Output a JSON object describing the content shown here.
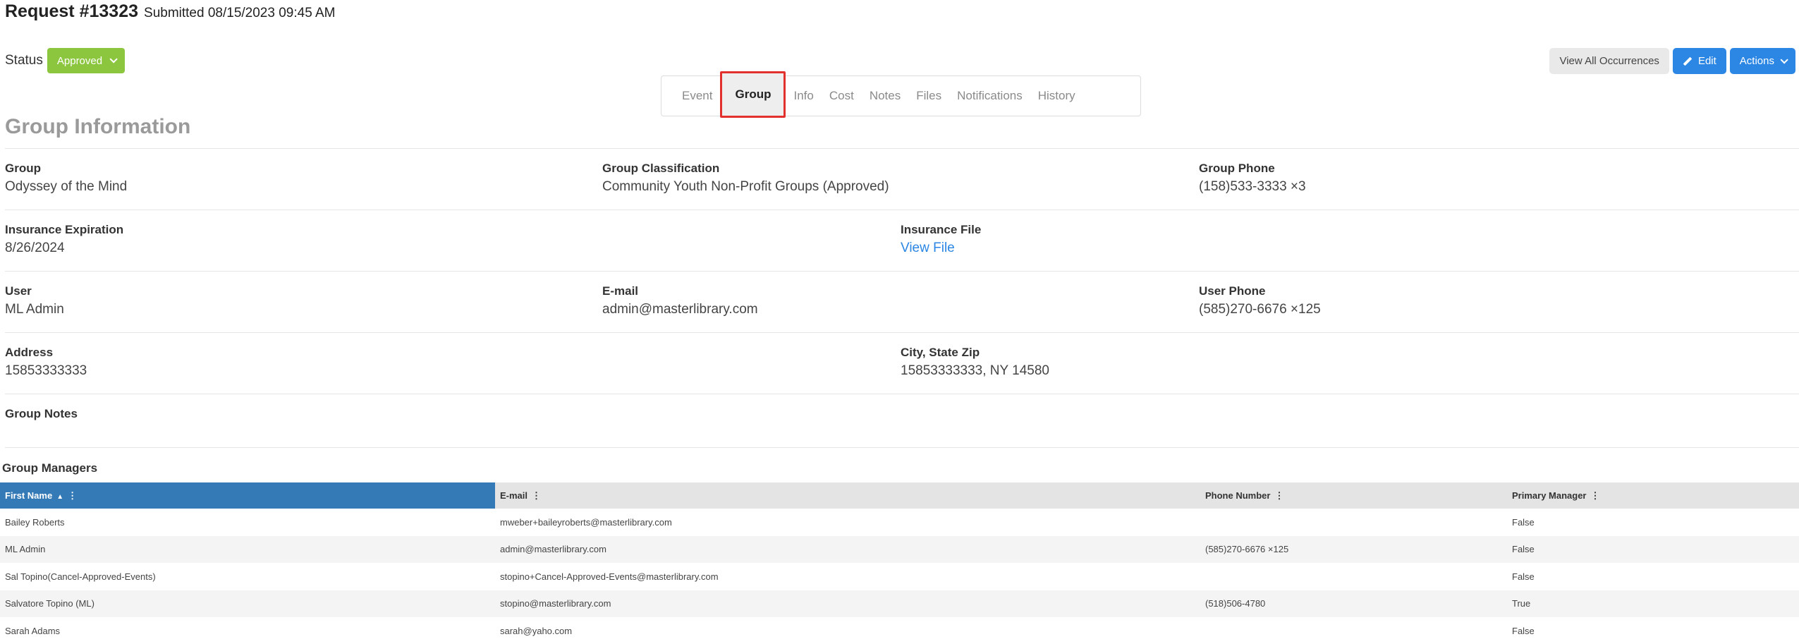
{
  "header": {
    "request": "Request #13323",
    "submitted": "Submitted 08/15/2023 09:45 AM"
  },
  "status": {
    "label": "Status",
    "value": "Approved",
    "color": "#8cc63f"
  },
  "actions": {
    "view_all": "View All Occurrences",
    "edit": "Edit",
    "actions": "Actions"
  },
  "tabs": [
    "Event",
    "Group",
    "Info",
    "Cost",
    "Notes",
    "Files",
    "Notifications",
    "History"
  ],
  "active_tab": "Group",
  "section_title": "Group Information",
  "fields": {
    "group": {
      "label": "Group",
      "value": "Odyssey of the Mind"
    },
    "classification": {
      "label": "Group Classification",
      "value": "Community Youth Non-Profit Groups (Approved)"
    },
    "group_phone": {
      "label": "Group Phone",
      "value": "(158)533-3333 ×3"
    },
    "insurance_exp": {
      "label": "Insurance Expiration",
      "value": "8/26/2024"
    },
    "insurance_file": {
      "label": "Insurance File",
      "value": "View File"
    },
    "user": {
      "label": "User",
      "value": "ML Admin"
    },
    "email": {
      "label": "E-mail",
      "value": "admin@masterlibrary.com"
    },
    "user_phone": {
      "label": "User Phone",
      "value": "(585)270-6676 ×125"
    },
    "address": {
      "label": "Address",
      "value": "15853333333"
    },
    "city": {
      "label": "City, State Zip",
      "value": "15853333333, NY 14580"
    },
    "notes": {
      "label": "Group Notes",
      "value": ""
    }
  },
  "managers": {
    "title": "Group Managers",
    "columns": [
      "First Name",
      "E-mail",
      "Phone Number",
      "Primary Manager"
    ],
    "rows": [
      [
        "Bailey Roberts",
        "mweber+baileyroberts@masterlibrary.com",
        "",
        "False"
      ],
      [
        "ML Admin",
        "admin@masterlibrary.com",
        "(585)270-6676 ×125",
        "False"
      ],
      [
        "Sal Topino(Cancel-Approved-Events)",
        "stopino+Cancel-Approved-Events@masterlibrary.com",
        "",
        "False"
      ],
      [
        "Salvatore Topino (ML)",
        "stopino@masterlibrary.com",
        "(518)506-4780",
        "True"
      ],
      [
        "Sarah Adams",
        "sarah@yaho.com",
        "",
        "False"
      ]
    ]
  },
  "colors": {
    "accent": "#2b86e4",
    "table_header_sorted": "#337ab7",
    "tab_highlight": "#e2312d"
  }
}
